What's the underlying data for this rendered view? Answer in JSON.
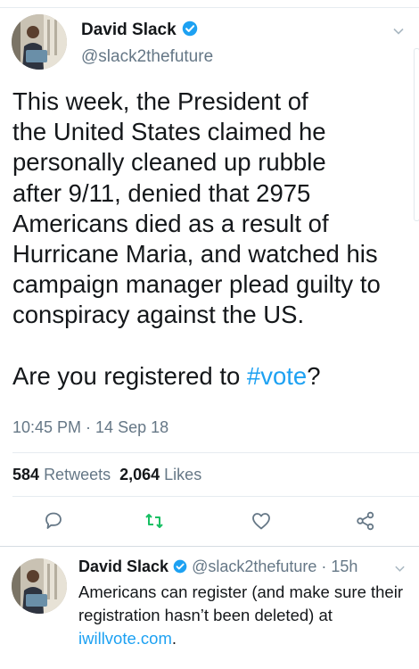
{
  "tweet": {
    "author_name": "David Slack",
    "handle": "@slack2thefuture",
    "text_lines": [
      "This week, the President of",
      "the United States claimed he",
      "personally cleaned up rubble",
      "after 9/11, denied that 2975",
      "Americans died as a result of",
      "Hurricane Maria, and watched his",
      "campaign manager plead guilty to",
      "conspiracy against the US."
    ],
    "question_prefix": "Are you registered to ",
    "hashtag": "#vote",
    "question_suffix": "?",
    "timestamp": "10:45 PM · 14 Sep 18",
    "retweets_count": "584",
    "retweets_label": "Retweets",
    "likes_count": "2,064",
    "likes_label": "Likes"
  },
  "actions": {
    "reply_icon": "reply-icon",
    "retweet_icon": "retweet-icon",
    "like_icon": "heart-icon",
    "share_icon": "share-icon",
    "retweet_color": "#17bf63"
  },
  "reply": {
    "author_name": "David Slack",
    "handle": "@slack2thefuture",
    "age": "15h",
    "text": "Americans can register (and make sure their registration hasn’t been deleted) at ",
    "link": "iwillvote.com",
    "text_end": "."
  },
  "colors": {
    "accent": "#1da1f2",
    "secondary_text": "#657786",
    "primary_text": "#14171a"
  }
}
